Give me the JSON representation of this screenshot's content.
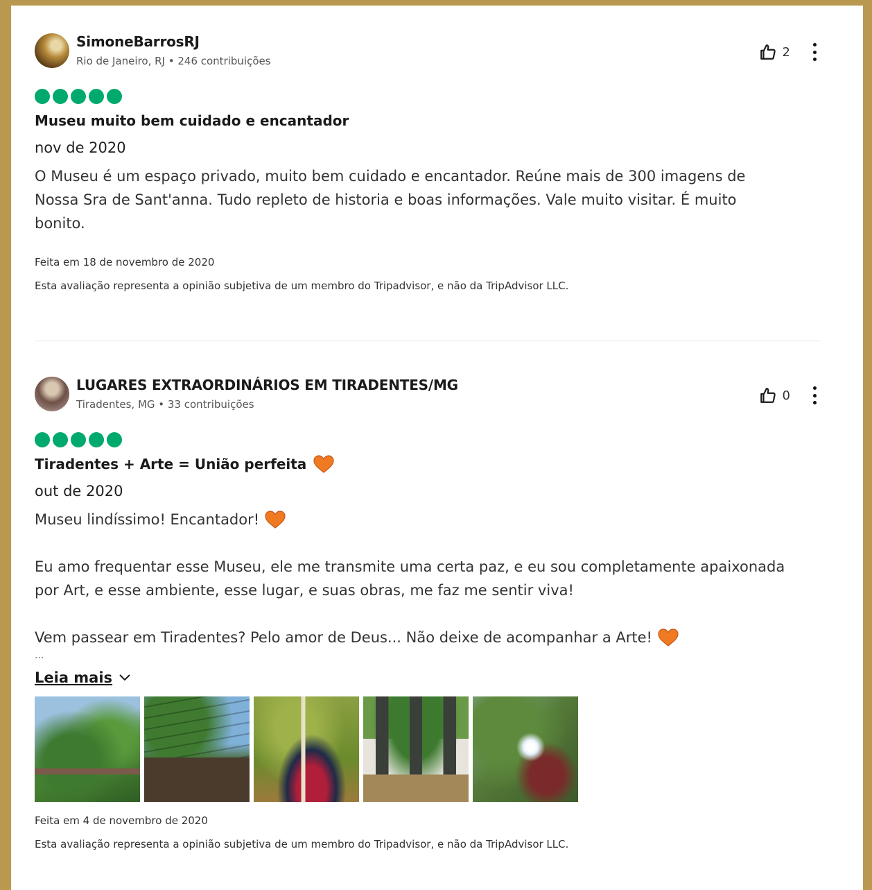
{
  "reviews": [
    {
      "user": "SimoneBarrosRJ",
      "meta": "Rio de Janeiro, RJ • 246 contribuições",
      "helpful_count": "2",
      "rating": 5,
      "title": "Museu muito bem cuidado e encantador",
      "date": "nov de 2020",
      "body": [
        "O Museu é um espaço privado, muito bem cuidado e encantador. Reúne mais de 300 imagens de",
        "Nossa Sra de Sant'anna. Tudo repleto de historia e boas informações. Vale muito visitar. É muito",
        "bonito."
      ],
      "written": "Feita em 18 de novembro de 2020",
      "disclaimer": "Esta avaliação representa a opinião subjetiva de um membro do Tripadvisor, e não da TripAdvisor LLC."
    },
    {
      "user": "LUGARES EXTRAORDINÁRIOS EM TIRADENTES/MG",
      "meta": "Tiradentes, MG • 33 contribuições",
      "helpful_count": "0",
      "rating": 5,
      "title": "Tiradentes + Arte = União perfeita",
      "date": "out de 2020",
      "body": [
        "Museu lindíssimo! Encantador!",
        "",
        "Eu amo frequentar esse Museu, ele me transmite uma certa paz, e eu sou completamente apaixonada",
        "por Art, e esse ambiente, esse lugar, e suas obras, me faz me sentir viva!",
        "",
        "Vem passear em Tiradentes? Pelo amor de Deus... Não deixe de acompanhar a Arte!"
      ],
      "ellipsis": "...",
      "read_more": "Leia mais",
      "written": "Feita em 4 de novembro de 2020",
      "disclaimer": "Esta avaliação representa a opinião subjetiva de um membro do Tripadvisor, e não da TripAdvisor LLC."
    }
  ],
  "icons": {
    "helpful": "thumbs-up-icon",
    "more": "more-options-icon",
    "heart": "orange-heart-emoji",
    "chevron": "chevron-down-icon"
  },
  "colors": {
    "rating_bubble": "#00aa6c",
    "heart": "#f07a22",
    "frame": "#b8994f"
  }
}
